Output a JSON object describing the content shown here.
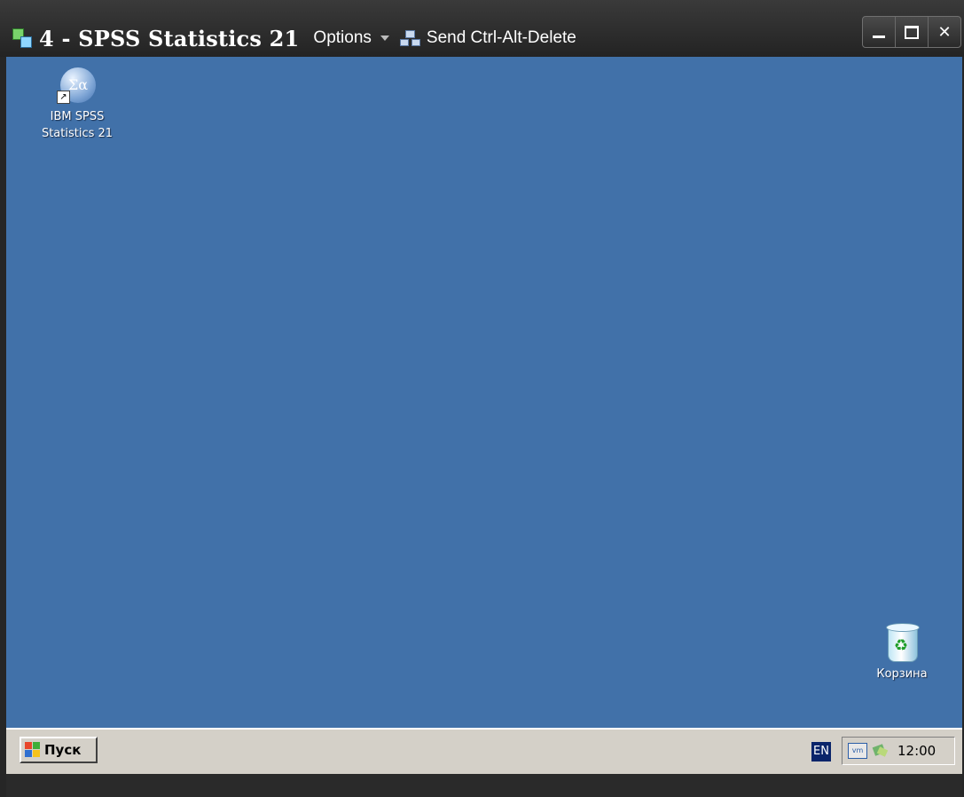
{
  "window": {
    "title": "4 - SPSS Statistics 21",
    "options_label": "Options",
    "send_cad_label": "Send Ctrl-Alt-Delete",
    "controls": {
      "minimize": "minimize-icon",
      "maximize": "maximize-icon",
      "close": "✕"
    }
  },
  "desktop": {
    "background_color": "#4171a9",
    "icons": [
      {
        "label_line1": "IBM SPSS",
        "label_line2": "Statistics 21",
        "icon": "spss-icon"
      },
      {
        "label": "Корзина",
        "icon": "recycle-bin-icon"
      }
    ],
    "spss_symbol": "Σα"
  },
  "taskbar": {
    "start_label": "Пуск",
    "language": "EN",
    "tray_vm_label": "vm",
    "clock": "12:00"
  }
}
